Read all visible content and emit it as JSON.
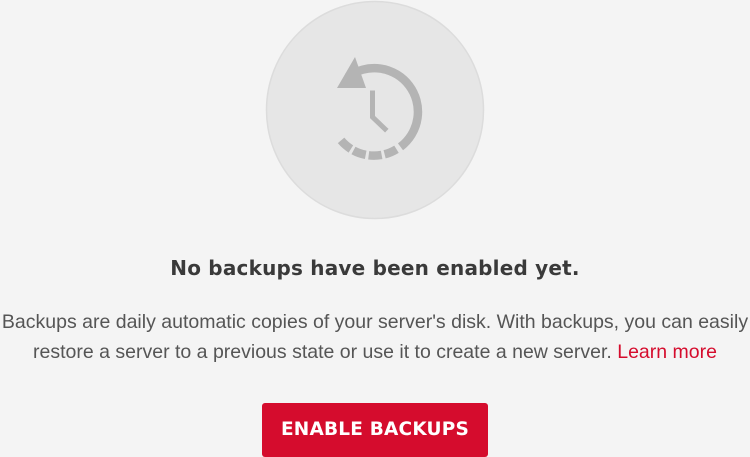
{
  "empty_state": {
    "icon": "backup-history-clock-icon",
    "heading": "No backups have been enabled yet.",
    "description": "Backups are daily automatic copies of your server's disk. With backups, you can easily restore a server to a previous state or use it to create a new server.",
    "learn_more": "Learn more",
    "button_label": "ENABLE BACKUPS"
  },
  "colors": {
    "accent": "#d50c2d",
    "background": "#f4f4f4",
    "icon_circle": "#e6e6e6",
    "icon_glyph": "#b4b4b4"
  }
}
